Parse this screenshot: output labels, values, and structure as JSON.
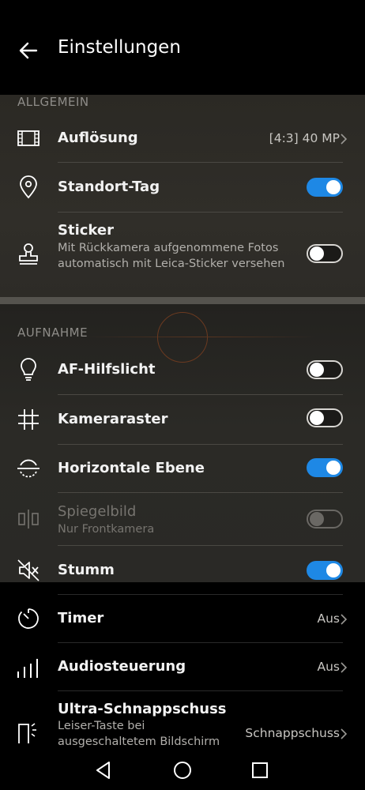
{
  "header": {
    "title": "Einstellungen"
  },
  "sections": {
    "general": "ALLGEMEIN",
    "capture": "AUFNAHME"
  },
  "general": {
    "resolution": {
      "label": "Auflösung",
      "value": "[4:3] 40 MP"
    },
    "location": {
      "label": "Standort-Tag",
      "enabled": true
    },
    "sticker": {
      "label": "Sticker",
      "sub": "Mit Rückkamera aufgenommene Fotos automatisch mit Leica-Sticker versehen",
      "enabled": false
    }
  },
  "capture": {
    "af_light": {
      "label": "AF-Hilfslicht",
      "enabled": false
    },
    "grid": {
      "label": "Kameraraster",
      "enabled": false
    },
    "level": {
      "label": "Horizontale Ebene",
      "enabled": true
    },
    "mirror": {
      "label": "Spiegelbild",
      "sub": "Nur Frontkamera",
      "enabled": false,
      "disabled": true
    },
    "mute": {
      "label": "Stumm",
      "enabled": true
    },
    "timer": {
      "label": "Timer",
      "value": "Aus"
    },
    "audio": {
      "label": "Audiosteuerung",
      "value": "Aus"
    },
    "ultra": {
      "label": "Ultra-Schnappschuss",
      "sub": "Leiser-Taste bei ausgeschaltetem Bildschirm",
      "value": "Schnappschuss"
    }
  },
  "colors": {
    "accent": "#1e88e5",
    "background": "#000000",
    "panel": "#2d2b27"
  },
  "nav": {
    "back": "triangle-back-icon",
    "home": "circle-home-icon",
    "recent": "square-recent-icon"
  }
}
